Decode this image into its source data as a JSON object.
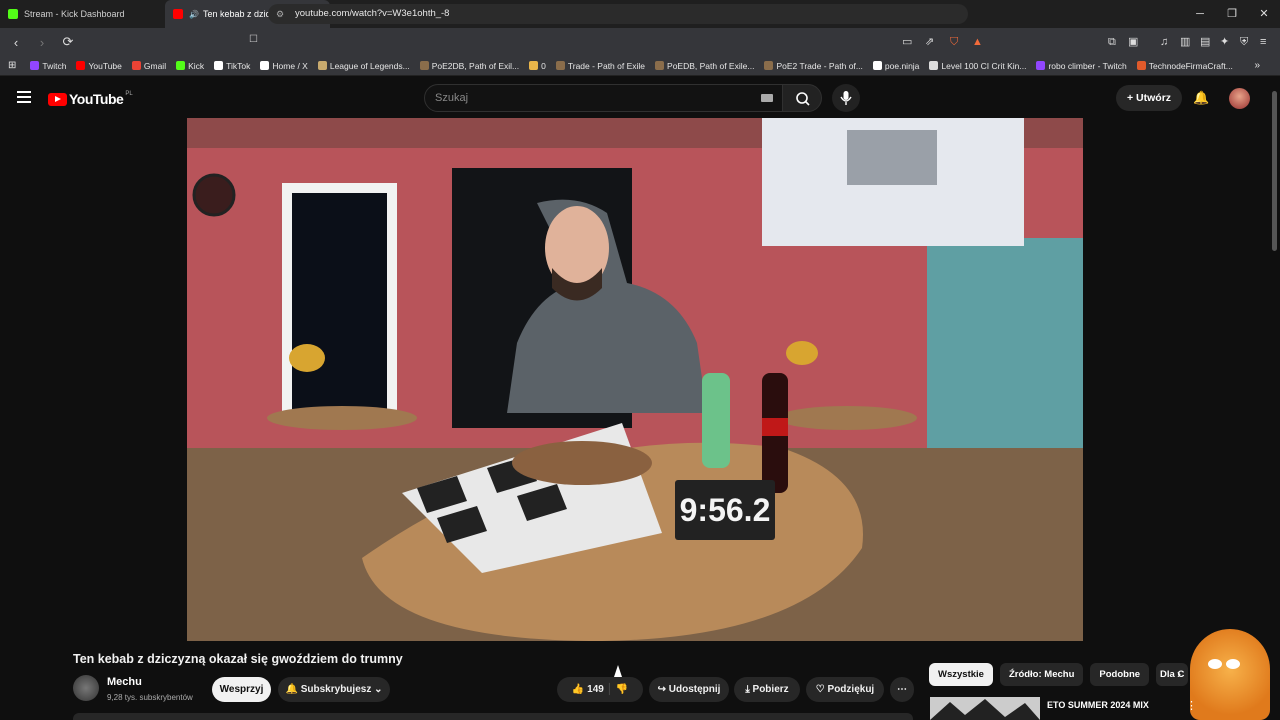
{
  "browser": {
    "tabs": [
      {
        "title": "Stream - Kick Dashboard",
        "favicon_color": "#53fc18"
      },
      {
        "title": "Ten kebab z dziczyzną okazał",
        "favicon_color": "#ff0000"
      }
    ],
    "url": "youtube.com/watch?v=W3e1ohth_-8",
    "bookmarks": [
      {
        "label": "Twitch",
        "color": "#9146ff"
      },
      {
        "label": "YouTube",
        "color": "#ff0000"
      },
      {
        "label": "Gmail",
        "color": "#ea4335"
      },
      {
        "label": "Kick",
        "color": "#53fc18"
      },
      {
        "label": "TikTok",
        "color": "#ffffff"
      },
      {
        "label": "Home / X",
        "color": "#ffffff"
      },
      {
        "label": "League of Legends...",
        "color": "#c8aa6e"
      },
      {
        "label": "PoE2DB, Path of Exil...",
        "color": "#8a6d4b"
      },
      {
        "label": "0",
        "color": "#e8b54a"
      },
      {
        "label": "Trade - Path of Exile",
        "color": "#8a6d4b"
      },
      {
        "label": "PoEDB, Path of Exile...",
        "color": "#8a6d4b"
      },
      {
        "label": "PoE2 Trade - Path of...",
        "color": "#8a6d4b"
      },
      {
        "label": "poe.ninja",
        "color": "#ffffff"
      },
      {
        "label": "Level 100 CI Crit Kin...",
        "color": "#dddddd"
      },
      {
        "label": "robo climber - Twitch",
        "color": "#9146ff"
      },
      {
        "label": "TechnodeFirmaCraft...",
        "color": "#e05a2b"
      }
    ]
  },
  "youtube": {
    "logo": "YouTube",
    "region": "PL",
    "search_placeholder": "Szukaj",
    "create_label": "Utwórz",
    "video_overlay": {
      "timer": "9:56.2"
    },
    "video": {
      "title": "Ten kebab z dziczyzną okazał się gwoździem do trumny",
      "channel": "Mechu",
      "subscribers": "9,28 tys. subskrybentów",
      "support": "Wesprzyj",
      "subscribed": "Subskrybujesz",
      "likes": "149",
      "share": "Udostępnij",
      "download": "Pobierz",
      "thanks": "Podziękuj"
    },
    "chips": [
      "Wszystkie",
      "Źródło: Mechu",
      "Podobne",
      "Dla C"
    ],
    "recommendation": {
      "title": "ETO SUMMER 2024 MIX"
    }
  }
}
